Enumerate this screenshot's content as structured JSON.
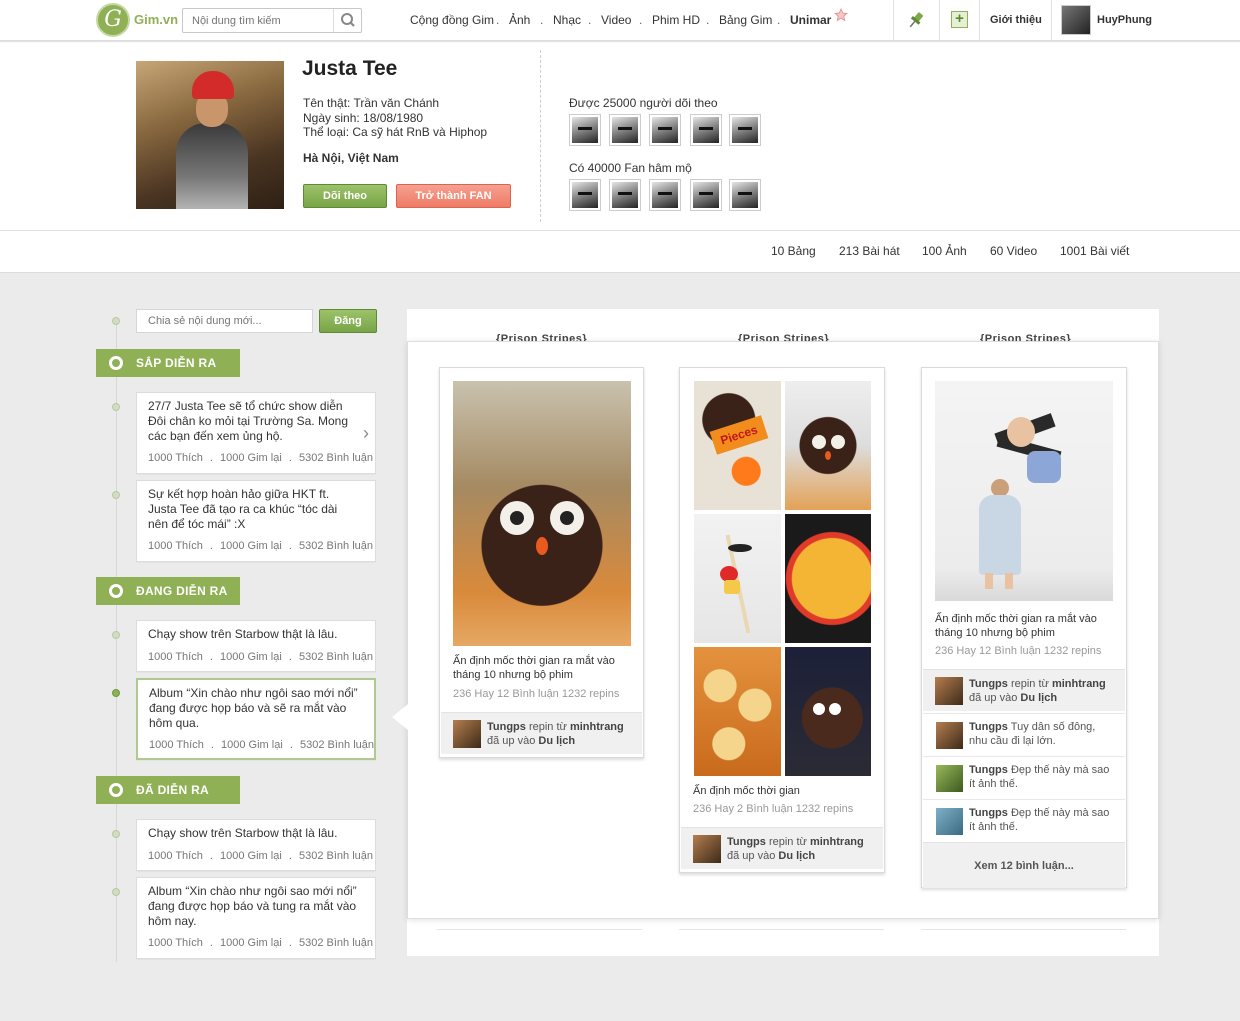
{
  "topbar": {
    "logo_letter": "G",
    "logo_text": "Gim.vn",
    "search_placeholder": "Nội dung tìm kiếm",
    "nav": [
      {
        "label": "Cộng đồng Gim"
      },
      {
        "label": "Ảnh"
      },
      {
        "label": "Nhạc"
      },
      {
        "label": "Video"
      },
      {
        "label": "Phim HD"
      },
      {
        "label": "Bảng Gim"
      },
      {
        "label": "Unimar"
      }
    ],
    "nav_separator": ".",
    "about_label": "Giới thiệu",
    "username": "HuyPhung",
    "plus_icon": "plus-icon",
    "pin_icon": "pin-icon"
  },
  "profile": {
    "name": "Justa Tee",
    "real_name": "Tên thật: Trần văn Chánh",
    "birthday": "Ngày sinh: 18/08/1980",
    "genre": "Thể loại: Ca sỹ hát RnB và Hiphop",
    "location": "Hà Nội, Việt Nam",
    "follow_button": "Dõi theo",
    "fan_button": "Trở thành FAN",
    "followers_label": "Được 25000 người dõi theo",
    "fans_label": "Có 40000 Fan hâm mộ"
  },
  "stats": [
    "10 Bảng",
    "213 Bài hát",
    "100 Ảnh",
    "60 Video",
    "1001 Bài viết"
  ],
  "composer": {
    "placeholder": "Chia sẻ nội dung mới...",
    "submit": "Đăng"
  },
  "timeline": {
    "sections": [
      {
        "label": "SẮP DIỄN RA"
      },
      {
        "label": "ĐANG DIỄN RA"
      },
      {
        "label": "ĐÃ DIỄN RA"
      }
    ],
    "posts": [
      {
        "text": "27/7 Justa Tee sẽ tổ chức show diễn Đôi chân ko mỏi tại Trường Sa. Mong các bạn đến xem ủng hộ.",
        "likes": "1000 Thích",
        "regims": "1000 Gim lại",
        "comments": "5302 Bình luận"
      },
      {
        "text": "Sự kết hợp hoàn hảo giữa HKT ft. Justa Tee đã tạo ra ca khúc “tóc dài nên để tóc mái” :X",
        "likes": "1000 Thích",
        "regims": "1000 Gim lại",
        "comments": "5302 Bình luận"
      },
      {
        "text": "Chạy show trên Starbow thật là lâu.",
        "likes": "1000 Thích",
        "regims": "1000 Gim lại",
        "comments": "5302 Bình luận"
      },
      {
        "text": "Album “Xin chào như ngôi sao mới nổi” đang được họp báo và sẽ ra mắt vào hôm qua.",
        "likes": "1000 Thích",
        "regims": "1000 Gim lại",
        "comments": "5302 Bình luận"
      },
      {
        "text": "Chạy show trên Starbow thật là lâu.",
        "likes": "1000 Thích",
        "regims": "1000 Gim lại",
        "comments": "5302 Bình luận"
      },
      {
        "text": "Album “Xin chào như ngôi sao mới nổi” đang được họp báo và tung ra mắt vào hôm nay.",
        "likes": "1000 Thích",
        "regims": "1000 Gim lại",
        "comments": "5302 Bình luận"
      }
    ],
    "meta_separator": "."
  },
  "board": {
    "column_titles": [
      "{Prison Stripes}",
      "{Prison Stripes}",
      "{Prison Stripes}"
    ],
    "pins": [
      {
        "title": "Ấn định mốc thời gian ra mắt vào tháng 10 nhưng bộ phim",
        "meta": "236 Hay   12 Bình luận   1232 repins",
        "repin_user": "Tungps",
        "repin_from_text": " repin từ ",
        "repin_from": "minhtrang",
        "repin_to_text": "đã up vào ",
        "repin_to": "Du lịch"
      },
      {
        "title": "Ấn định mốc thời gian",
        "meta": "236 Hay   2 Bình luận   1232 repins",
        "repin_user": "Tungps",
        "repin_from_text": " repin từ ",
        "repin_from": "minhtrang",
        "repin_to_text": "đã up vào ",
        "repin_to": "Du lịch"
      },
      {
        "title": "Ấn định mốc thời gian ra mắt vào tháng 10 nhưng bộ phim",
        "meta": "236 Hay   12 Bình luận   1232 repins",
        "repin_user": "Tungps",
        "repin_from_text": " repin từ ",
        "repin_from": "minhtrang",
        "repin_to_text": "đã up vào ",
        "repin_to": "Du lịch"
      }
    ],
    "comments": [
      {
        "user": "Tungps",
        "text": " Tuy dân số đông, nhu cầu đi lại lớn."
      },
      {
        "user": "Tungps",
        "text": " Đẹp thế này mà sao ít ảnh thế."
      },
      {
        "user": "Tungps",
        "text": " Đẹp thế này mà sao ít ảnh thế."
      }
    ],
    "more_comments": "Xem 12 bình luận...",
    "candy_label": "Pieces"
  },
  "colors": {
    "accent": "#8fb055",
    "fan_button": "#ef7b66"
  }
}
